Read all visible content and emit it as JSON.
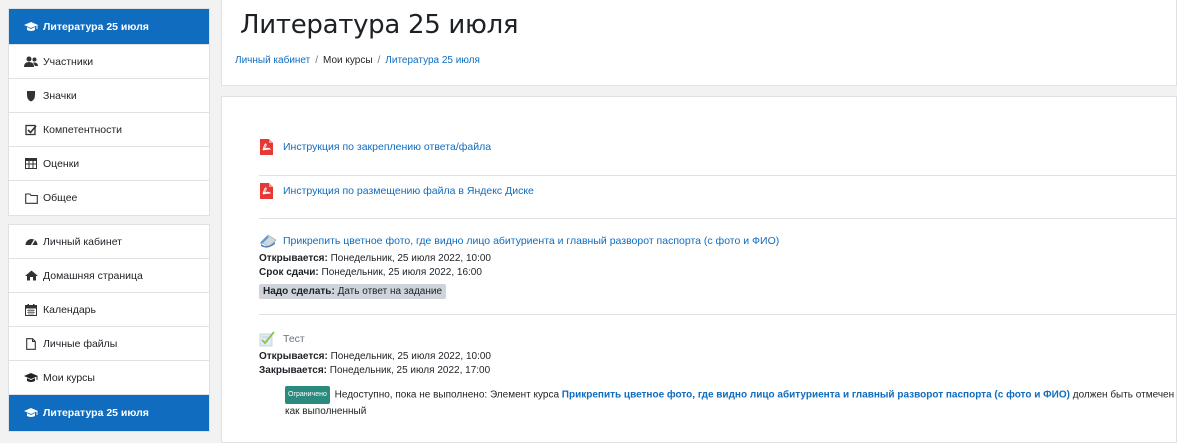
{
  "sidebar": {
    "course_items": [
      {
        "label": "Литература 25 июля",
        "icon": "graduation-cap-icon"
      },
      {
        "label": "Участники",
        "icon": "users-icon"
      },
      {
        "label": "Значки",
        "icon": "shield-icon"
      },
      {
        "label": "Компетентности",
        "icon": "checkbox-icon"
      },
      {
        "label": "Оценки",
        "icon": "table-icon"
      },
      {
        "label": "Общее",
        "icon": "folder-icon"
      }
    ],
    "site_items": [
      {
        "label": "Личный кабинет",
        "icon": "dashboard-icon"
      },
      {
        "label": "Домашняя страница",
        "icon": "home-icon"
      },
      {
        "label": "Календарь",
        "icon": "calendar-icon"
      },
      {
        "label": "Личные файлы",
        "icon": "file-icon"
      },
      {
        "label": "Мои курсы",
        "icon": "graduation-cap-icon"
      },
      {
        "label": "Литература 25 июля",
        "icon": "graduation-cap-icon"
      }
    ]
  },
  "header": {
    "title": "Литература 25 июля",
    "breadcrumb": [
      "Личный кабинет",
      "Мои курсы",
      "Литература 25 июля"
    ],
    "separator": "/"
  },
  "activities": {
    "pdf1": {
      "title": "Инструкция по закреплению ответа/файла"
    },
    "pdf2": {
      "title": "Инструкция по размещению файла в Яндекс Диске"
    },
    "assign": {
      "title": "Прикрепить цветное фото, где видно лицо абитуриента и главный разворот паспорта (с фото и ФИО)",
      "opens_label": "Открывается:",
      "opens_value": "Понедельник, 25 июля 2022, 10:00",
      "due_label": "Срок сдачи:",
      "due_value": "Понедельник, 25 июля 2022, 16:00",
      "todo_label": "Надо сделать:",
      "todo_value": "Дать ответ на задание"
    },
    "quiz": {
      "title": "Тест",
      "opens_label": "Открывается:",
      "opens_value": "Понедельник, 25 июля 2022, 10:00",
      "closes_label": "Закрывается:",
      "closes_value": "Понедельник, 25 июля 2022, 17:00",
      "badge": "Ограничено",
      "restriction_prefix": "Недоступно, пока не выполнено: Элемент курса",
      "restriction_link": "Прикрепить цветное фото, где видно лицо абитуриента и главный разворот паспорта (с фото и ФИО)",
      "restriction_suffix": "должен быть отмечен как выполненный"
    }
  },
  "colors": {
    "accent": "#0f6cbf",
    "badge": "#2b8a7e",
    "pdf_red": "#d32f2f"
  }
}
